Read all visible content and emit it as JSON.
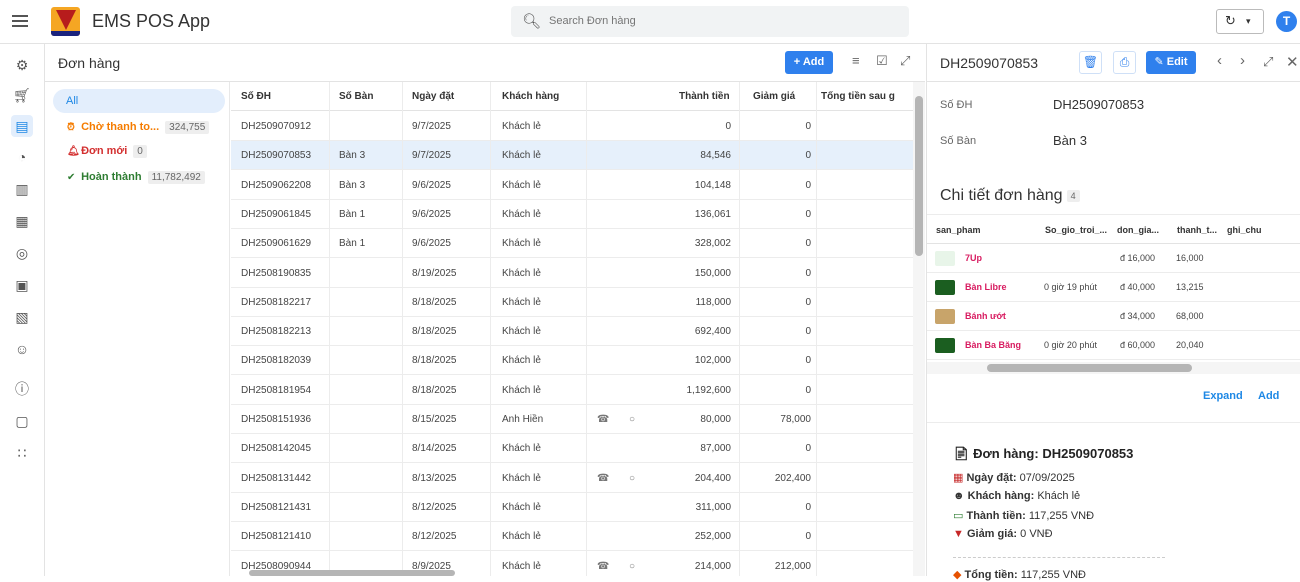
{
  "app": {
    "title": "EMS POS App",
    "avatar_initial": "T"
  },
  "search": {
    "placeholder": "Search Đơn hàng"
  },
  "left_nav": [
    "settings-icon",
    "cart-icon",
    "document-icon",
    "dashboard-icon",
    "report-icon",
    "inventory-icon",
    "database-icon",
    "info-box-icon",
    "file-icon",
    "users-icon",
    "info-icon",
    "feedback-icon",
    "apps-icon"
  ],
  "list": {
    "title": "Đơn hàng",
    "add_label": "+ Add",
    "status": {
      "all": "All",
      "items": [
        {
          "label": "Chờ thanh to...",
          "count": "324,755",
          "color": "#f57c00"
        },
        {
          "label": "Đơn mới",
          "count": "0",
          "color": "#d32f2f"
        },
        {
          "label": "Hoàn thành",
          "count": "11,782,492",
          "color": "#2e7d32"
        }
      ]
    },
    "columns": [
      "Số ĐH",
      "Số Bàn",
      "Ngày đặt",
      "Khách hàng",
      "Thành tiền",
      "Giảm giá",
      "Tổng tiền sau g"
    ],
    "rows": [
      {
        "id": "DH2509070912",
        "ban": "",
        "ngay": "9/7/2025",
        "kh": "Khách lẻ",
        "tt": "0",
        "gg": "0"
      },
      {
        "id": "DH2509070853",
        "ban": "Bàn 3",
        "ngay": "9/7/2025",
        "kh": "Khách lẻ",
        "tt": "84,546",
        "gg": "0"
      },
      {
        "id": "DH2509062208",
        "ban": "Bàn 3",
        "ngay": "9/6/2025",
        "kh": "Khách lẻ",
        "tt": "104,148",
        "gg": "0"
      },
      {
        "id": "DH2509061845",
        "ban": "Bàn 1",
        "ngay": "9/6/2025",
        "kh": "Khách lẻ",
        "tt": "136,061",
        "gg": "0"
      },
      {
        "id": "DH2509061629",
        "ban": "Bàn 1",
        "ngay": "9/6/2025",
        "kh": "Khách lẻ",
        "tt": "328,002",
        "gg": "0"
      },
      {
        "id": "DH2508190835",
        "ban": "",
        "ngay": "8/19/2025",
        "kh": "Khách lẻ",
        "tt": "150,000",
        "gg": "0"
      },
      {
        "id": "DH2508182217",
        "ban": "",
        "ngay": "8/18/2025",
        "kh": "Khách lẻ",
        "tt": "118,000",
        "gg": "0"
      },
      {
        "id": "DH2508182213",
        "ban": "",
        "ngay": "8/18/2025",
        "kh": "Khách lẻ",
        "tt": "692,400",
        "gg": "0"
      },
      {
        "id": "DH2508182039",
        "ban": "",
        "ngay": "8/18/2025",
        "kh": "Khách lẻ",
        "tt": "102,000",
        "gg": "0"
      },
      {
        "id": "DH2508181954",
        "ban": "",
        "ngay": "8/18/2025",
        "kh": "Khách lẻ",
        "tt": "1,192,600",
        "gg": "0"
      },
      {
        "id": "DH2508151936",
        "ban": "",
        "ngay": "8/15/2025",
        "kh": "Anh Hiền",
        "tt": "80,000",
        "gg": "78,000"
      },
      {
        "id": "DH2508142045",
        "ban": "",
        "ngay": "8/14/2025",
        "kh": "Khách lẻ",
        "tt": "87,000",
        "gg": "0"
      },
      {
        "id": "DH2508131442",
        "ban": "",
        "ngay": "8/13/2025",
        "kh": "Khách lẻ",
        "tt": "204,400",
        "gg": "202,400"
      },
      {
        "id": "DH2508121431",
        "ban": "",
        "ngay": "8/12/2025",
        "kh": "Khách lẻ",
        "tt": "311,000",
        "gg": "0"
      },
      {
        "id": "DH2508121410",
        "ban": "",
        "ngay": "8/12/2025",
        "kh": "Khách lẻ",
        "tt": "252,000",
        "gg": "0"
      },
      {
        "id": "DH2508090944",
        "ban": "",
        "ngay": "8/9/2025",
        "kh": "Khách lẻ",
        "tt": "214,000",
        "gg": "212,000"
      }
    ]
  },
  "detail": {
    "title": "DH2509070853",
    "edit_label": "Edit",
    "fields": [
      {
        "label": "Số ĐH",
        "value": "DH2509070853"
      },
      {
        "label": "Số Bàn",
        "value": "Bàn 3"
      }
    ],
    "section_title": "Chi tiết đơn hàng",
    "section_count": "4",
    "sub_columns": [
      "san_pham",
      "So_gio_troi_...",
      "don_gia...",
      "thanh_t...",
      "ghi_chu"
    ],
    "sub_rows": [
      {
        "name": "7Up",
        "gio": "",
        "gia": "đ 16,000",
        "tt": "16,000"
      },
      {
        "name": "Bàn Libre",
        "gio": "0 giờ 19 phút",
        "gia": "đ 40,000",
        "tt": "13,215"
      },
      {
        "name": "Bánh ướt",
        "gio": "",
        "gia": "đ 34,000",
        "tt": "68,000"
      },
      {
        "name": "Bàn Ba Băng",
        "gio": "0 giờ 20 phút",
        "gia": "đ 60,000",
        "tt": "20,040"
      }
    ],
    "expand_label": "Expand",
    "add_label": "Add",
    "summary": {
      "title": "Đơn hàng: DH2509070853",
      "date_label": "Ngày đặt:",
      "date": "07/09/2025",
      "customer_label": "Khách hàng:",
      "customer": "Khách lẻ",
      "amount_label": "Thành tiền:",
      "amount": "117,255 VNĐ",
      "discount_label": "Giảm giá:",
      "discount": "0 VNĐ",
      "total_label": "Tổng tiền:",
      "total": "117,255 VNĐ"
    }
  }
}
